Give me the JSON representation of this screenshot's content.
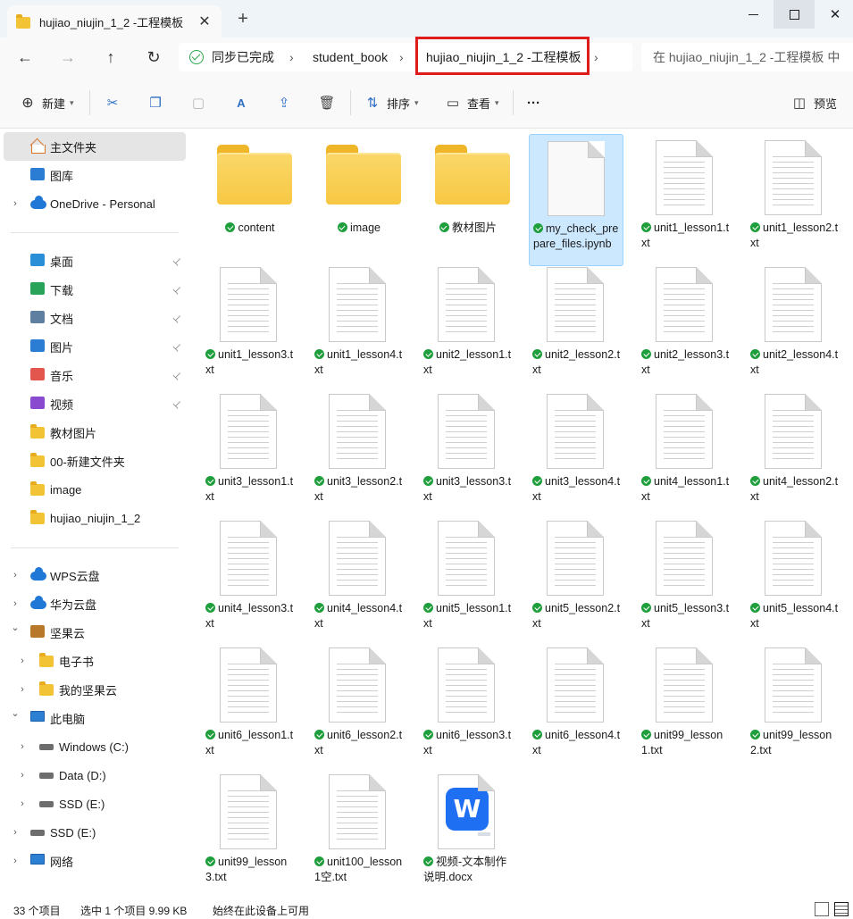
{
  "window": {
    "tab_title": "hujiao_niujin_1_2 -工程模板",
    "tab_close": "✕",
    "new_tab": "+"
  },
  "nav": {
    "back": "←",
    "forward": "→",
    "up": "↑",
    "refresh": "↻"
  },
  "address": {
    "sync_status": "同步已完成",
    "crumbs": [
      "student_book",
      "hujiao_niujin_1_2 -工程模板"
    ],
    "separator": "›"
  },
  "search": {
    "placeholder": "在 hujiao_niujin_1_2 -工程模板 中"
  },
  "commands": {
    "new_label": "新建",
    "sort_label": "排序",
    "view_label": "查看",
    "more_label": "···",
    "preview_label": "预览"
  },
  "sidebar": {
    "home": "主文件夹",
    "gallery": "图库",
    "onedrive": "OneDrive - Personal",
    "quick_access": [
      "桌面",
      "下载",
      "文档",
      "图片",
      "音乐",
      "视频",
      "教材图片",
      "00-新建文件夹",
      "image",
      "hujiao_niujin_1_2"
    ],
    "pin_glyph": "📌",
    "wps": "WPS云盘",
    "huawei": "华为云盘",
    "jianguo": "坚果云",
    "ebook": "电子书",
    "my_jianguo": "我的坚果云",
    "this_pc": "此电脑",
    "drive_c": "Windows (C:)",
    "drive_d": "Data (D:)",
    "drive_e": "SSD (E:)",
    "drive_e2": "SSD (E:)",
    "network": "网络",
    "chevron_right": "›",
    "chevron_down": "⌄"
  },
  "files": [
    {
      "name": "content",
      "kind": "folder"
    },
    {
      "name": "image",
      "kind": "folder"
    },
    {
      "name": "教材图片",
      "kind": "folder"
    },
    {
      "name": "my_check_prepare_files.ipynb",
      "kind": "plain",
      "selected": true
    },
    {
      "name": "unit1_lesson1.txt",
      "kind": "txt"
    },
    {
      "name": "unit1_lesson2.txt",
      "kind": "txt"
    },
    {
      "name": "unit1_lesson3.txt",
      "kind": "txt"
    },
    {
      "name": "unit1_lesson4.txt",
      "kind": "txt"
    },
    {
      "name": "unit2_lesson1.txt",
      "kind": "txt"
    },
    {
      "name": "unit2_lesson2.txt",
      "kind": "txt"
    },
    {
      "name": "unit2_lesson3.txt",
      "kind": "txt"
    },
    {
      "name": "unit2_lesson4.txt",
      "kind": "txt"
    },
    {
      "name": "unit3_lesson1.txt",
      "kind": "txt"
    },
    {
      "name": "unit3_lesson2.txt",
      "kind": "txt"
    },
    {
      "name": "unit3_lesson3.txt",
      "kind": "txt"
    },
    {
      "name": "unit3_lesson4.txt",
      "kind": "txt"
    },
    {
      "name": "unit4_lesson1.txt",
      "kind": "txt"
    },
    {
      "name": "unit4_lesson2.txt",
      "kind": "txt"
    },
    {
      "name": "unit4_lesson3.txt",
      "kind": "txt"
    },
    {
      "name": "unit4_lesson4.txt",
      "kind": "txt"
    },
    {
      "name": "unit5_lesson1.txt",
      "kind": "txt"
    },
    {
      "name": "unit5_lesson2.txt",
      "kind": "txt"
    },
    {
      "name": "unit5_lesson3.txt",
      "kind": "txt"
    },
    {
      "name": "unit5_lesson4.txt",
      "kind": "txt"
    },
    {
      "name": "unit6_lesson1.txt",
      "kind": "txt"
    },
    {
      "name": "unit6_lesson2.txt",
      "kind": "txt"
    },
    {
      "name": "unit6_lesson3.txt",
      "kind": "txt"
    },
    {
      "name": "unit6_lesson4.txt",
      "kind": "txt"
    },
    {
      "name": "unit99_lesson1.txt",
      "kind": "txt"
    },
    {
      "name": "unit99_lesson2.txt",
      "kind": "txt"
    },
    {
      "name": "unit99_lesson3.txt",
      "kind": "txt"
    },
    {
      "name": "unit100_lesson1空.txt",
      "kind": "txt"
    },
    {
      "name": "视频-文本制作说明.docx",
      "kind": "wps"
    }
  ],
  "wps_logo_letter": "W",
  "status": {
    "count": "33 个项目",
    "selection": "选中 1 个项目  9.99 KB",
    "availability": "始终在此设备上可用"
  },
  "colors": {
    "accent": "#2d6fc4",
    "selection_bg": "#cce8ff",
    "sync_ok": "#1f9e3c",
    "highlight_box": "#e01b1b"
  }
}
